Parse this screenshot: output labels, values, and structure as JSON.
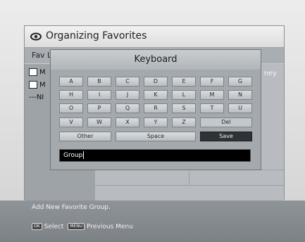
{
  "window": {
    "title": "Organizing Favorites",
    "column_label": "Fav L",
    "right_partial_label": "ney",
    "list": [
      {
        "icon": "folder-icon",
        "text": "M"
      },
      {
        "icon": "folder-icon",
        "text": "M"
      },
      {
        "icon": "",
        "text": "---NI"
      }
    ]
  },
  "keyboard": {
    "title": "Keyboard",
    "rows": [
      [
        "A",
        "B",
        "C",
        "D",
        "E",
        "F",
        "G"
      ],
      [
        "H",
        "I",
        "J",
        "K",
        "L",
        "M",
        "N"
      ],
      [
        "O",
        "P",
        "Q",
        "R",
        "S",
        "T",
        "U"
      ],
      [
        "V",
        "W",
        "X",
        "Y",
        "Z"
      ]
    ],
    "del_label": "Del",
    "other_label": "Other",
    "space_label": "Space",
    "save_label": "Save",
    "input_value": "Group"
  },
  "info": {
    "message": "Add New Favorite Group.",
    "ok_badge": "OK",
    "select_label": "Select",
    "menu_badge": "MENU",
    "previous_label": "Previous Menu"
  }
}
